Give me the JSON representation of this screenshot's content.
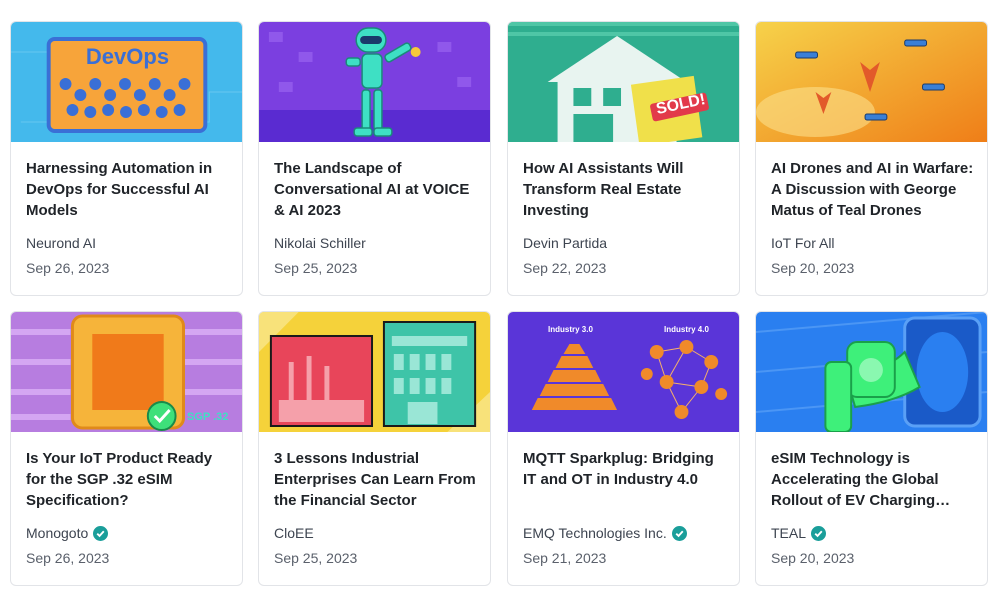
{
  "articles": [
    {
      "title": "Harnessing Automation in DevOps for Successful AI Models",
      "author": "Neurond AI",
      "verified": false,
      "date": "Sep 26, 2023",
      "thumbnail": {
        "icon": "devops-gears-illustration",
        "sign_text": "DevOps",
        "colors": [
          "#3bb6ea",
          "#f7a43a"
        ]
      }
    },
    {
      "title": "The Landscape of Conversational AI at VOICE & AI 2023",
      "author": "Nikolai Schiller",
      "verified": false,
      "date": "Sep 25, 2023",
      "thumbnail": {
        "icon": "robot-microphone-illustration",
        "colors": [
          "#7b3fe0",
          "#3ee0c4"
        ]
      }
    },
    {
      "title": "How AI Assistants Will Transform Real Estate Investing",
      "author": "Devin Partida",
      "verified": false,
      "date": "Sep 22, 2023",
      "thumbnail": {
        "icon": "house-sold-sign-illustration",
        "sign_text": "SOLD!",
        "colors": [
          "#2fae8f",
          "#f0e04a"
        ]
      }
    },
    {
      "title": "AI Drones and AI in Warfare: A Discussion with George Matus of Teal Drones",
      "author": "IoT For All",
      "verified": false,
      "date": "Sep 20, 2023",
      "thumbnail": {
        "icon": "drones-fighter-jets-illustration",
        "colors": [
          "#f6c23a",
          "#f08a1c"
        ]
      }
    },
    {
      "title": "Is Your IoT Product Ready for the SGP .32 eSIM Specification?",
      "author": "Monogoto",
      "verified": true,
      "date": "Sep 26, 2023",
      "thumbnail": {
        "icon": "esim-chip-illustration",
        "sign_text": "SGP .32",
        "colors": [
          "#b77de0",
          "#f6b43a"
        ]
      }
    },
    {
      "title": "3 Lessons Industrial Enterprises Can Learn From the Financial Sector",
      "author": "CloEE",
      "verified": false,
      "date": "Sep 25, 2023",
      "thumbnail": {
        "icon": "factory-and-bank-illustration",
        "colors": [
          "#f5d23a",
          "#e8455a"
        ]
      }
    },
    {
      "title": "MQTT Sparkplug: Bridging IT and OT in Industry 4.0",
      "author": "EMQ Technologies Inc.",
      "verified": true,
      "date": "Sep 21, 2023",
      "thumbnail": {
        "icon": "industry-pyramid-network-diagram",
        "labels": [
          "Industry 3.0",
          "Industry 4.0"
        ],
        "colors": [
          "#5a35d8",
          "#f08a2a"
        ]
      }
    },
    {
      "title": "eSIM Technology is Accelerating the Global Rollout of EV Charging Stations",
      "author": "TEAL",
      "verified": true,
      "date": "Sep 20, 2023",
      "thumbnail": {
        "icon": "ev-charger-plug-illustration",
        "colors": [
          "#2a7ff0",
          "#3ef07a"
        ]
      }
    }
  ],
  "colors": {
    "verified_badge": "#1a9e9a",
    "card_border": "#e2e4e8",
    "title_text": "#1f2328"
  }
}
